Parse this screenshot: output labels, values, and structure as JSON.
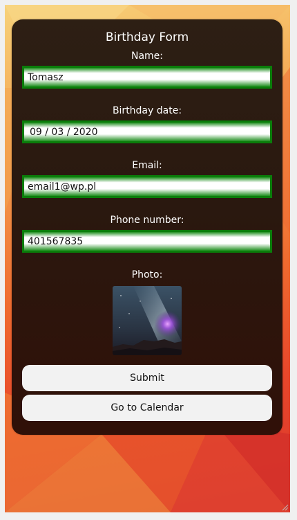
{
  "form": {
    "title": "Birthday Form",
    "name_label": "Name:",
    "name_value": "Tomasz",
    "birthday_label": "Birthday date:",
    "birthday_value": "09 / 03 / 2020",
    "email_label": "Email:",
    "email_value": "email1@wp.pl",
    "phone_label": "Phone number:",
    "phone_value": "401567835",
    "photo_label": "Photo:",
    "submit_label": "Submit",
    "calendar_label": "Go to Calendar"
  },
  "icons": {
    "photo": "milky-way-photo",
    "resize": "resize-grip-icon"
  },
  "colors": {
    "field_border": "#0a7d0a",
    "card_background": "#2a180f",
    "button_background": "#f2f2f2"
  }
}
